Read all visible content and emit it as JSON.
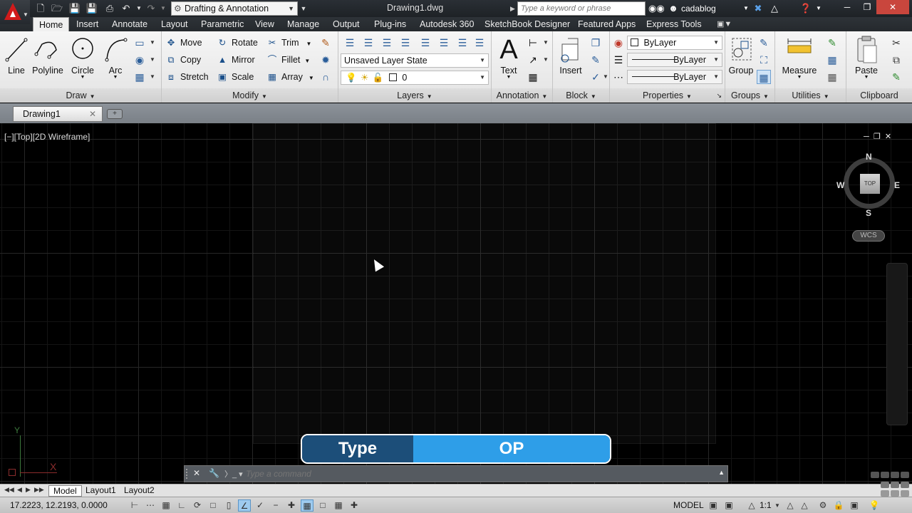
{
  "titlebar": {
    "workspace": "Drafting & Annotation",
    "document_title": "Drawing1.dwg",
    "search_placeholder": "Type a keyword or phrase",
    "user": "cadablog"
  },
  "ribbon_tabs": [
    "Home",
    "Insert",
    "Annotate",
    "Layout",
    "Parametric",
    "View",
    "Manage",
    "Output",
    "Plug-ins",
    "Autodesk 360",
    "SketchBook Designer",
    "Featured Apps",
    "Express Tools"
  ],
  "draw": {
    "title": "Draw",
    "line": "Line",
    "polyline": "Polyline",
    "circle": "Circle",
    "arc": "Arc"
  },
  "modify": {
    "title": "Modify",
    "move": "Move",
    "rotate": "Rotate",
    "trim": "Trim",
    "copy": "Copy",
    "mirror": "Mirror",
    "fillet": "Fillet",
    "stretch": "Stretch",
    "scale": "Scale",
    "array": "Array"
  },
  "layers": {
    "title": "Layers",
    "layer_state": "Unsaved Layer State",
    "current_layer": "0"
  },
  "annotation": {
    "title": "Annotation",
    "text": "Text"
  },
  "block": {
    "title": "Block",
    "insert": "Insert"
  },
  "properties": {
    "title": "Properties",
    "color": "ByLayer",
    "linetype": "ByLayer",
    "lineweight": "ByLayer"
  },
  "groups": {
    "title": "Groups",
    "group": "Group"
  },
  "utilities": {
    "title": "Utilities",
    "measure": "Measure"
  },
  "clipboard": {
    "title": "Clipboard",
    "paste": "Paste"
  },
  "file_tab": {
    "name": "Drawing1"
  },
  "viewport": {
    "label": "[−][Top][2D Wireframe]",
    "viewcube_top": "TOP",
    "compass": {
      "n": "N",
      "s": "S",
      "e": "E",
      "w": "W"
    },
    "wcs": "WCS",
    "ucs_x": "X",
    "ucs_y": "Y"
  },
  "overlay": {
    "label": "Type",
    "value": "OP"
  },
  "command_line": {
    "placeholder": "Type a command"
  },
  "layout_tabs": [
    "Model",
    "Layout1",
    "Layout2"
  ],
  "status_bar": {
    "coordinates": "17.2223, 12.2193, 0.0000",
    "space": "MODEL",
    "annotation_scale": "1:1"
  },
  "colors": {
    "accent_red": "#d11b1b",
    "overlay_dark": "#1c4e79",
    "overlay_light": "#2e9ee8",
    "canvas": "#000000"
  }
}
